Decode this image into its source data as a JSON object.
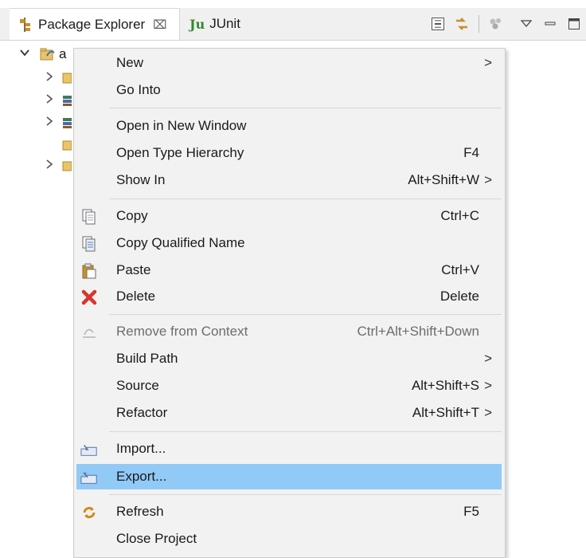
{
  "tabs": {
    "package_explorer": "Package Explorer",
    "package_explorer_close": "⌧",
    "junit_icon_text": "Ju",
    "junit": "JUnit"
  },
  "tree": {
    "root_label": "a"
  },
  "menu": {
    "groups": [
      [
        {
          "label": "New",
          "accel": "",
          "submenu": true,
          "icon": ""
        },
        {
          "label": "Go Into",
          "accel": "",
          "submenu": false,
          "icon": ""
        }
      ],
      [
        {
          "label": "Open in New Window",
          "accel": "",
          "submenu": false,
          "icon": ""
        },
        {
          "label": "Open Type Hierarchy",
          "accel": "F4",
          "submenu": false,
          "icon": ""
        },
        {
          "label": "Show In",
          "accel": "Alt+Shift+W",
          "submenu": true,
          "icon": ""
        }
      ],
      [
        {
          "label": "Copy",
          "accel": "Ctrl+C",
          "submenu": false,
          "icon": "copy-icon"
        },
        {
          "label": "Copy Qualified Name",
          "accel": "",
          "submenu": false,
          "icon": "copy-qualified-name-icon"
        },
        {
          "label": "Paste",
          "accel": "Ctrl+V",
          "submenu": false,
          "icon": "paste-icon"
        },
        {
          "label": "Delete",
          "accel": "Delete",
          "submenu": false,
          "icon": "delete-icon"
        }
      ],
      [
        {
          "label": "Remove from Context",
          "accel": "Ctrl+Alt+Shift+Down",
          "submenu": false,
          "icon": "remove-from-context-icon",
          "disabled": true
        },
        {
          "label": "Build Path",
          "accel": "",
          "submenu": true,
          "icon": ""
        },
        {
          "label": "Source",
          "accel": "Alt+Shift+S",
          "submenu": true,
          "icon": ""
        },
        {
          "label": "Refactor",
          "accel": "Alt+Shift+T",
          "submenu": true,
          "icon": ""
        }
      ],
      [
        {
          "label": "Import...",
          "accel": "",
          "submenu": false,
          "icon": "import-icon"
        },
        {
          "label": "Export...",
          "accel": "",
          "submenu": false,
          "icon": "export-icon",
          "selected": true
        }
      ],
      [
        {
          "label": "Refresh",
          "accel": "F5",
          "submenu": false,
          "icon": "refresh-icon"
        },
        {
          "label": "Close Project",
          "accel": "",
          "submenu": false,
          "icon": ""
        }
      ]
    ],
    "submenu_arrow": ">",
    "selection_color": "#91c9f7"
  }
}
